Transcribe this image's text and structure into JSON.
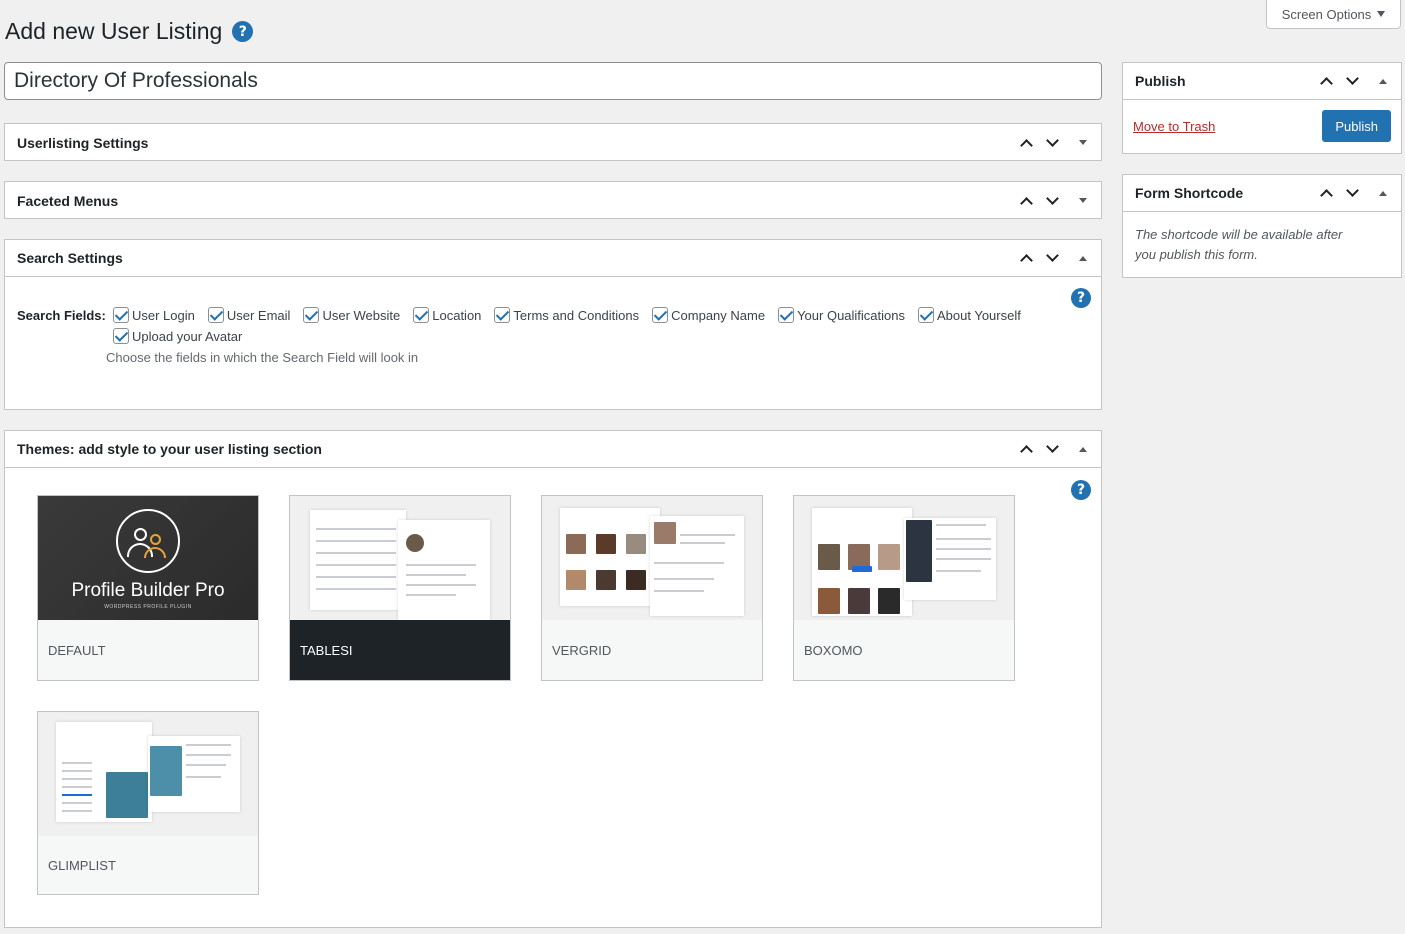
{
  "page": {
    "title": "Add new User Listing",
    "screen_options_label": "Screen Options"
  },
  "title_field": {
    "value": "Directory Of Professionals"
  },
  "panels": {
    "userlisting_settings": "Userlisting Settings",
    "faceted_menus": "Faceted Menus",
    "search_settings": "Search Settings",
    "themes": "Themes: add style to your user listing section"
  },
  "search": {
    "label": "Search Fields:",
    "fields": [
      "User Login",
      "User Email",
      "User Website",
      "Location",
      "Terms and Conditions",
      "Company Name",
      "Your Qualifications",
      "About Yourself",
      "Upload your Avatar"
    ],
    "description": "Choose the fields in which the Search Field will look in"
  },
  "themes": {
    "items": [
      {
        "name": "DEFAULT",
        "active": false
      },
      {
        "name": "TABLESI",
        "active": true
      },
      {
        "name": "VERGRID",
        "active": false
      },
      {
        "name": "BOXOMO",
        "active": false
      },
      {
        "name": "GLIMPLIST",
        "active": false
      }
    ],
    "default_thumb_title": "Profile Builder Pro",
    "default_thumb_subtitle": "WORDPRESS PROFILE PLUGIN"
  },
  "publish": {
    "title": "Publish",
    "trash_label": "Move to Trash",
    "publish_label": "Publish"
  },
  "shortcode": {
    "title": "Form Shortcode",
    "note": "The shortcode will be available after you publish this form."
  },
  "help_icon": "?",
  "colors": {
    "accent": "#2271b1",
    "trash": "#b32d2e",
    "active_theme_bg": "#1d2327"
  }
}
